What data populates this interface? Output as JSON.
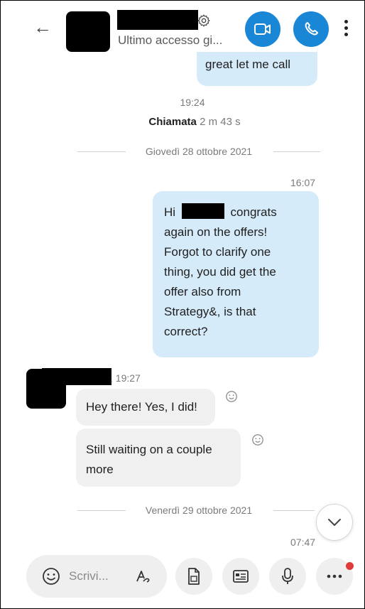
{
  "header": {
    "subtitle": "Ultimo accesso gi...",
    "icons": [
      "back-arrow-icon",
      "gear-icon",
      "video-call-icon",
      "phone-icon",
      "more-vertical-icon"
    ],
    "accent_color": "#1a86d6"
  },
  "messages": {
    "top_bubble": "great let me call",
    "call_time": "19:24",
    "call_label": "Chiamata",
    "call_duration": "2 m 43 s",
    "date_divider_1": "Giovedì 28 ottobre 2021",
    "out_time": "16:07",
    "out_lines": {
      "l1_start": "Hi",
      "l1_end": "congrats",
      "l2": "again on the offers!",
      "l3": "Forgot to clarify one",
      "l4": "thing, you did get the",
      "l5": "offer also from",
      "l6": "Strategy&, is that",
      "l7": "correct?"
    },
    "in_time": ", 19:27",
    "in_1": "Hey there! Yes, I did!",
    "in_2_line1": "Still waiting on a couple",
    "in_2_line2": "more",
    "date_divider_2": "Venerdì 29 ottobre 2021",
    "last_time": "07:47"
  },
  "composer": {
    "placeholder": "Scrivi..."
  }
}
